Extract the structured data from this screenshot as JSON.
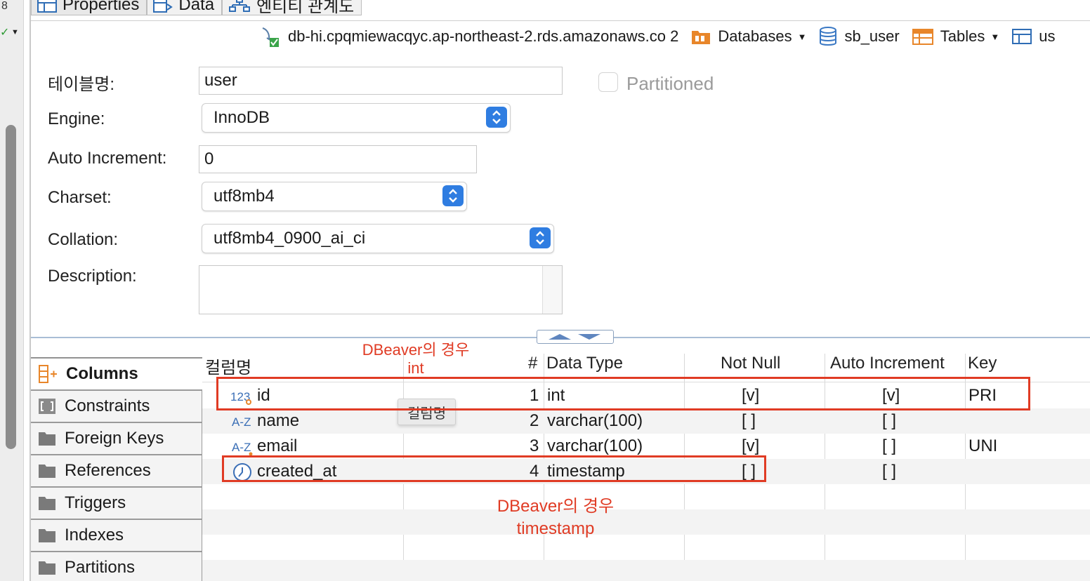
{
  "tabs": [
    {
      "label": "Properties",
      "icon": "properties-table-icon",
      "active": true
    },
    {
      "label": "Data",
      "icon": "data-icon"
    },
    {
      "label": "엔티티 관계도",
      "icon": "er-diagram-icon"
    }
  ],
  "breadcrumb": {
    "connection": "db-hi.cpqmiewacqyc.ap-northeast-2.rds.amazonaws.co 2",
    "databases": "Databases",
    "schema": "sb_user",
    "tables": "Tables",
    "table": "us"
  },
  "form": {
    "table_name_label": "테이블명:",
    "table_name": "user",
    "partitioned_label": "Partitioned",
    "engine_label": "Engine:",
    "engine": "InnoDB",
    "auto_increment_label": "Auto Increment:",
    "auto_increment": "0",
    "charset_label": "Charset:",
    "charset": "utf8mb4",
    "collation_label": "Collation:",
    "collation": "utf8mb4_0900_ai_ci",
    "description_label": "Description:",
    "description": ""
  },
  "side_tabs": [
    {
      "label": "Columns",
      "icon": "columns-icon",
      "active": true
    },
    {
      "label": "Constraints",
      "icon": "constraints-icon"
    },
    {
      "label": "Foreign Keys",
      "icon": "folder-icon"
    },
    {
      "label": "References",
      "icon": "folder-icon"
    },
    {
      "label": "Triggers",
      "icon": "folder-icon"
    },
    {
      "label": "Indexes",
      "icon": "folder-icon"
    },
    {
      "label": "Partitions",
      "icon": "folder-icon"
    }
  ],
  "columns_table": {
    "headers": {
      "name": "컬럼명",
      "num": "#",
      "type": "Data Type",
      "notnull": "Not Null",
      "autoinc": "Auto Increment",
      "key": "Key"
    },
    "rows": [
      {
        "icon": "numeric-key-icon",
        "name": "id",
        "num": "1",
        "type": "int",
        "notnull": "[v]",
        "autoinc": "[v]",
        "key": "PRI"
      },
      {
        "icon": "text-column-icon",
        "name": "name",
        "num": "2",
        "type": "varchar(100)",
        "notnull": "[ ]",
        "autoinc": "[ ]",
        "key": ""
      },
      {
        "icon": "text-column-icon",
        "name": "email",
        "num": "3",
        "type": "varchar(100)",
        "notnull": "[v]",
        "autoinc": "[ ]",
        "key": "UNI"
      },
      {
        "icon": "clock-icon",
        "name": "created_at",
        "num": "4",
        "type": "timestamp",
        "notnull": "[ ]",
        "autoinc": "[ ]",
        "key": ""
      }
    ]
  },
  "tooltip": "컬럼명",
  "annotations": {
    "top_note_line1": "DBeaver의 경우",
    "top_note_line2": "int",
    "bottom_note_line1": "DBeaver의 경우",
    "bottom_note_line2": "timestamp",
    "color": "#e03b24"
  },
  "colors": {
    "accent_blue": "#2f7de1",
    "folder_gray": "#7a7a7a",
    "db_orange": "#e8862a"
  }
}
